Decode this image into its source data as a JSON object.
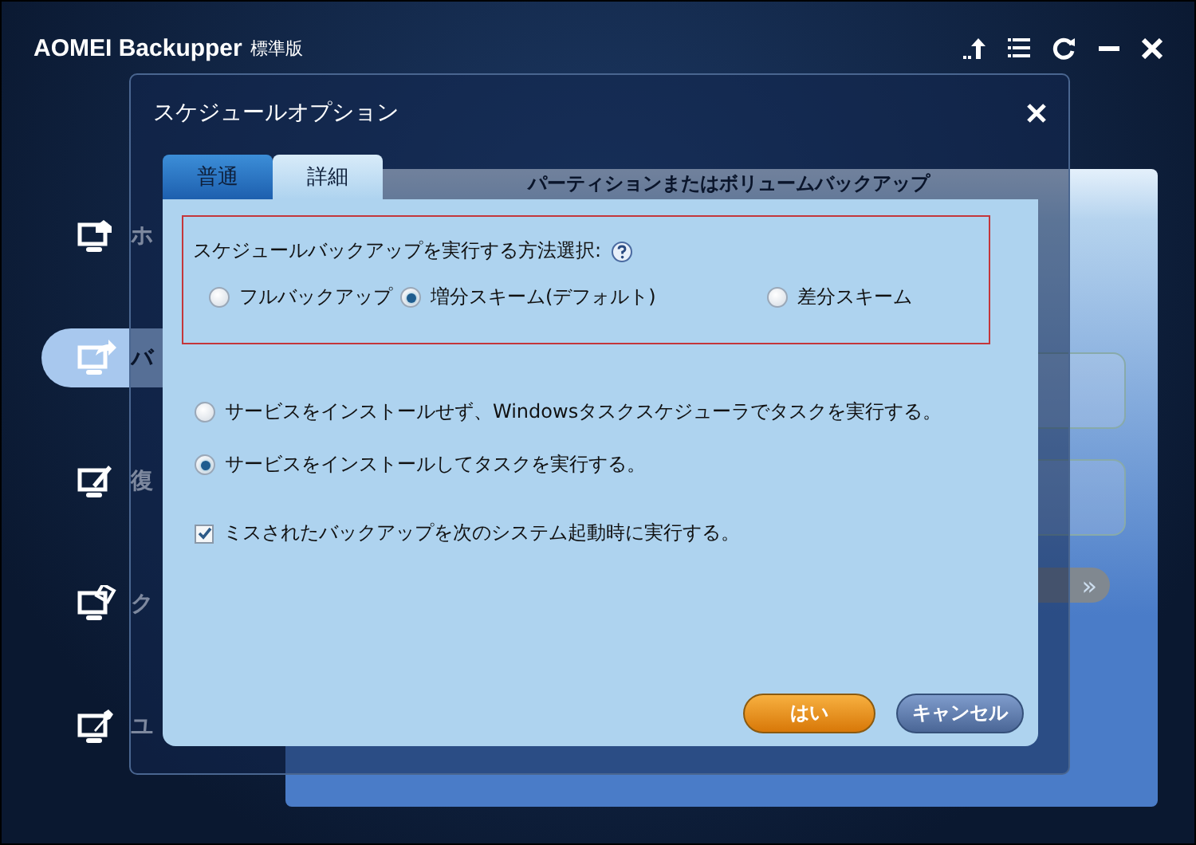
{
  "app": {
    "title": "AOMEI Backupper",
    "edition": "標準版"
  },
  "sidebar": {
    "items": [
      {
        "label": "ホ",
        "kind": "home",
        "selected": false
      },
      {
        "label": "バ",
        "kind": "backup",
        "selected": true
      },
      {
        "label": "復",
        "kind": "restore",
        "selected": false
      },
      {
        "label": "ク",
        "kind": "clone",
        "selected": false
      },
      {
        "label": "ユ",
        "kind": "tools",
        "selected": false
      }
    ]
  },
  "background_panel": {
    "title": "パーティションまたはボリュームバックアップ",
    "next_glyph": "»"
  },
  "dialog": {
    "title": "スケジュールオプション",
    "tabs": [
      {
        "label": "普通",
        "selected": false
      },
      {
        "label": "詳細",
        "selected": true
      }
    ],
    "method": {
      "label": "スケジュールバックアップを実行する方法選択:",
      "options": [
        {
          "label": "フルバックアップ",
          "selected": false
        },
        {
          "label": "増分スキーム(デフォルト)",
          "selected": true
        },
        {
          "label": "差分スキーム",
          "selected": false
        }
      ]
    },
    "service_options": [
      {
        "label": "サービスをインストールせず、Windowsタスクスケジューラでタスクを実行する。",
        "selected": false
      },
      {
        "label": "サービスをインストールしてタスクを実行する。",
        "selected": true
      }
    ],
    "run_missed": {
      "label": "ミスされたバックアップを次のシステム起動時に実行する。",
      "checked": true
    },
    "buttons": [
      {
        "label": "はい",
        "kind": "primary"
      },
      {
        "label": "キャンセル",
        "kind": "secondary"
      }
    ]
  }
}
